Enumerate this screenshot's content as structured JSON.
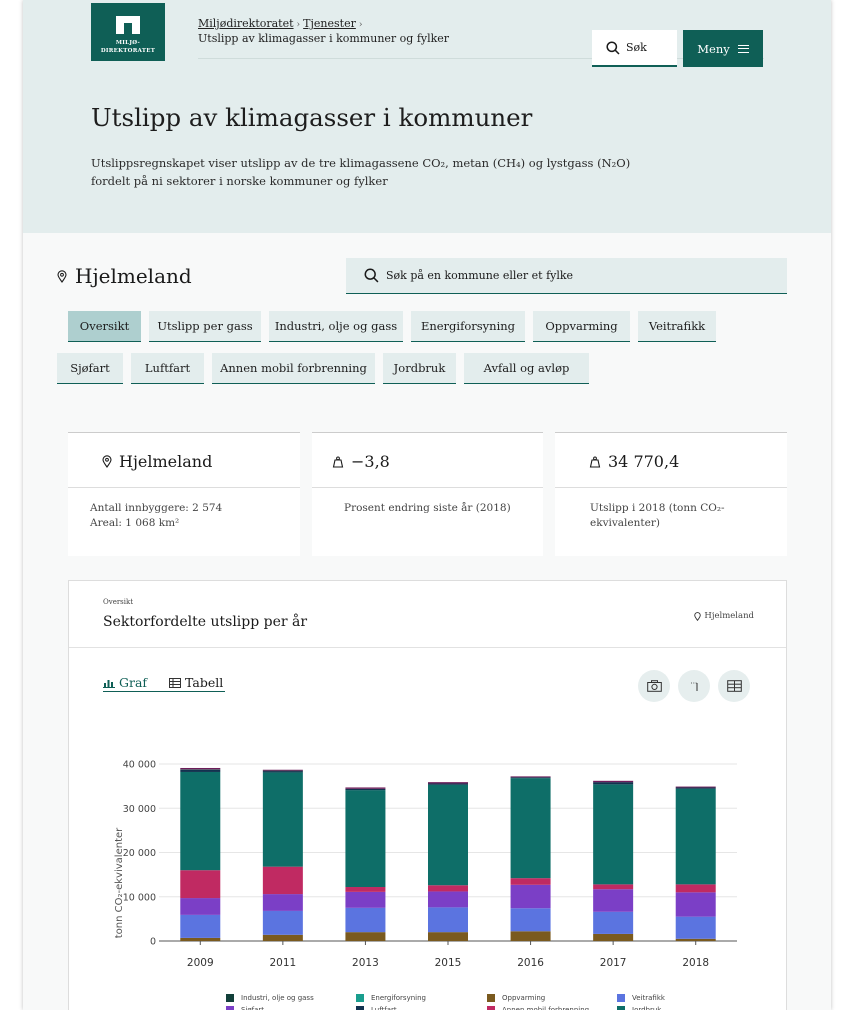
{
  "header": {
    "logo_line1": "MILJØ-",
    "logo_line2": "DIREKTORATET",
    "breadcrumb": [
      "Miljødirektoratet",
      "Tjenester"
    ],
    "breadcrumb_current": "Utslipp av klimagasser i kommuner og fylker",
    "search_label": "Søk",
    "menu_label": "Meny",
    "title": "Utslipp av klimagasser i kommuner",
    "intro_line1": "Utslippsregnskapet viser utslipp av de tre klimagassene CO₂, metan (CH₄) og lystgass (N₂O)",
    "intro_line2": "fordelt på ni sektorer i norske kommuner og fylker"
  },
  "location": {
    "name": "Hjelmeland",
    "search_placeholder": "Søk på en kommune eller et fylke"
  },
  "tabs": [
    {
      "label": "Oversikt",
      "active": true
    },
    {
      "label": "Utslipp per gass"
    },
    {
      "label": "Industri, olje og gass"
    },
    {
      "label": "Energiforsyning"
    },
    {
      "label": "Oppvarming"
    },
    {
      "label": "Veitrafikk"
    },
    {
      "label": "Sjøfart"
    },
    {
      "label": "Luftfart"
    },
    {
      "label": "Annen mobil forbrenning"
    },
    {
      "label": "Jordbruk"
    },
    {
      "label": "Avfall og avløp"
    }
  ],
  "cards": {
    "place": {
      "title": "Hjelmeland",
      "line1": "Antall innbyggere: 2 574",
      "line2": "Areal: 1 068 km²"
    },
    "change": {
      "value": "−3,8",
      "label": "Prosent endring siste år (2018)"
    },
    "emissions": {
      "value": "34 770,4",
      "label_line1": "Utslipp i 2018 (tonn CO₂-",
      "label_line2": "ekvivalenter)"
    }
  },
  "chart_panel": {
    "overline": "Oversikt",
    "title": "Sektorfordelte utslipp per år",
    "location": "Hjelmeland",
    "tab_graph": "Graf",
    "tab_table": "Tabell"
  },
  "colors": {
    "brand": "#0f5f56",
    "hero_bg": "#e3eded"
  },
  "chart_data": {
    "type": "bar",
    "stacked": true,
    "categories": [
      "2009",
      "2011",
      "2013",
      "2015",
      "2016",
      "2017",
      "2018"
    ],
    "ylabel": "tonn CO₂-ekvivalenter",
    "ylim": [
      0,
      40000
    ],
    "yticks": [
      0,
      10000,
      20000,
      30000,
      40000
    ],
    "ytick_labels": [
      "0",
      "10 000",
      "20 000",
      "30 000",
      "40 000"
    ],
    "grid": true,
    "legend_position": "bottom",
    "series": [
      {
        "name": "Oppvarming",
        "color": "#7a5a1f",
        "values": [
          700,
          1400,
          2000,
          2000,
          2200,
          1600,
          500
        ]
      },
      {
        "name": "Veitrafikk",
        "color": "#5b74e0",
        "values": [
          5200,
          5400,
          5500,
          5600,
          5200,
          5000,
          5000
        ]
      },
      {
        "name": "Sjøfart",
        "color": "#7b3fc6",
        "values": [
          3800,
          3800,
          3600,
          3600,
          5300,
          5100,
          5500
        ]
      },
      {
        "name": "Annen mobil forbrenning",
        "color": "#c02a62",
        "values": [
          6300,
          6200,
          1100,
          1400,
          1500,
          1100,
          1800
        ]
      },
      {
        "name": "Jordbruk",
        "color": "#0e6e68",
        "values": [
          22200,
          21300,
          21900,
          22700,
          22600,
          22600,
          21600
        ]
      },
      {
        "name": "Luftfart",
        "color": "#12324f",
        "values": [
          500,
          300,
          300,
          300,
          200,
          500,
          300
        ]
      },
      {
        "name": "Industri, olje og gass",
        "color": "#12403a",
        "values": [
          100,
          100,
          0,
          0,
          0,
          0,
          0
        ]
      },
      {
        "name": "Energiforsyning",
        "color": "#1a9e8e",
        "values": [
          0,
          0,
          0,
          0,
          0,
          0,
          0
        ]
      },
      {
        "name": "Avfall og avløp",
        "color": "#6e1d5a",
        "values": [
          300,
          200,
          300,
          300,
          200,
          300,
          200
        ]
      }
    ],
    "legend_visible": [
      {
        "name": "Industri, olje og gass",
        "color": "#12403a"
      },
      {
        "name": "Energiforsyning",
        "color": "#1a9e8e"
      },
      {
        "name": "Oppvarming",
        "color": "#7a5a1f"
      },
      {
        "name": "Veitrafikk",
        "color": "#5b74e0"
      },
      {
        "name": "Sjøfart",
        "color": "#7b3fc6"
      },
      {
        "name": "Luftfart",
        "color": "#12324f"
      },
      {
        "name": "Annen mobil forbrenning",
        "color": "#c02a62"
      },
      {
        "name": "Jordbruk",
        "color": "#0e6e68"
      }
    ]
  }
}
